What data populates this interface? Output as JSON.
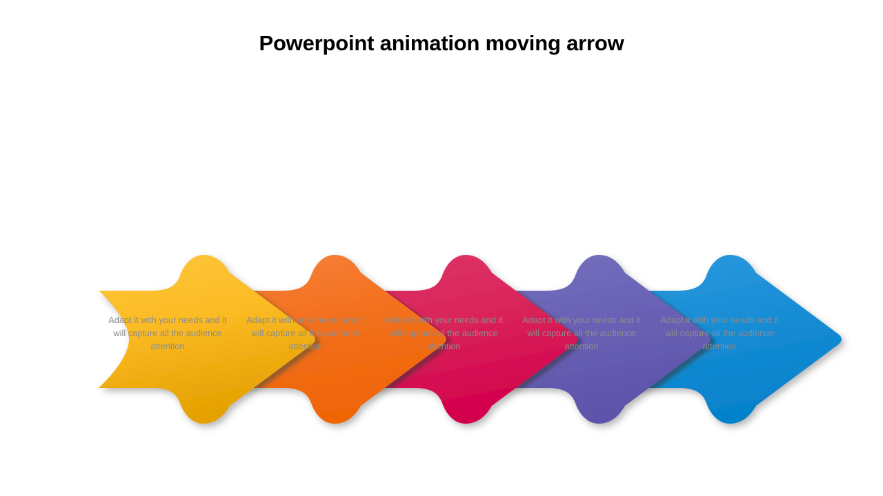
{
  "slide": {
    "title": "Powerpoint animation moving arrow",
    "background_color": "#ffffff"
  },
  "diagram": {
    "type": "chevron-arrow-process",
    "step_count": 5,
    "steps": [
      {
        "index": 1,
        "icon": "safe-vault-icon",
        "color_top": "#fcc02e",
        "color_bottom": "#e9a500",
        "shadow_color": "#b9631a",
        "caption": "Adapt it with your needs and it will capture all the audience attention"
      },
      {
        "index": 2,
        "icon": "atom-icon",
        "color_top": "#f4742b",
        "color_bottom": "#ef6a07",
        "shadow_color": "#9e1a3c",
        "caption": "Adapt it with your needs and it will capture all the audience attention"
      },
      {
        "index": 3,
        "icon": "presentation-board-icon",
        "color_top": "#da2a5e",
        "color_bottom": "#d4004f",
        "shadow_color": "#463f82",
        "caption": "Adapt it with your needs and it will capture all the audience attention"
      },
      {
        "index": 4,
        "icon": "film-strip-icon",
        "color_top": "#6e66b8",
        "color_bottom": "#6158ad",
        "shadow_color": "#0d5e8e",
        "caption": "Adapt it with your needs and it will capture all the audience attention"
      },
      {
        "index": 5,
        "icon": "layers-icon",
        "color_top": "#2191d8",
        "color_bottom": "#0785cd",
        "shadow_color": "#0d5e8e",
        "caption": "Adapt it with your needs and it will capture all the audience attention"
      }
    ]
  }
}
